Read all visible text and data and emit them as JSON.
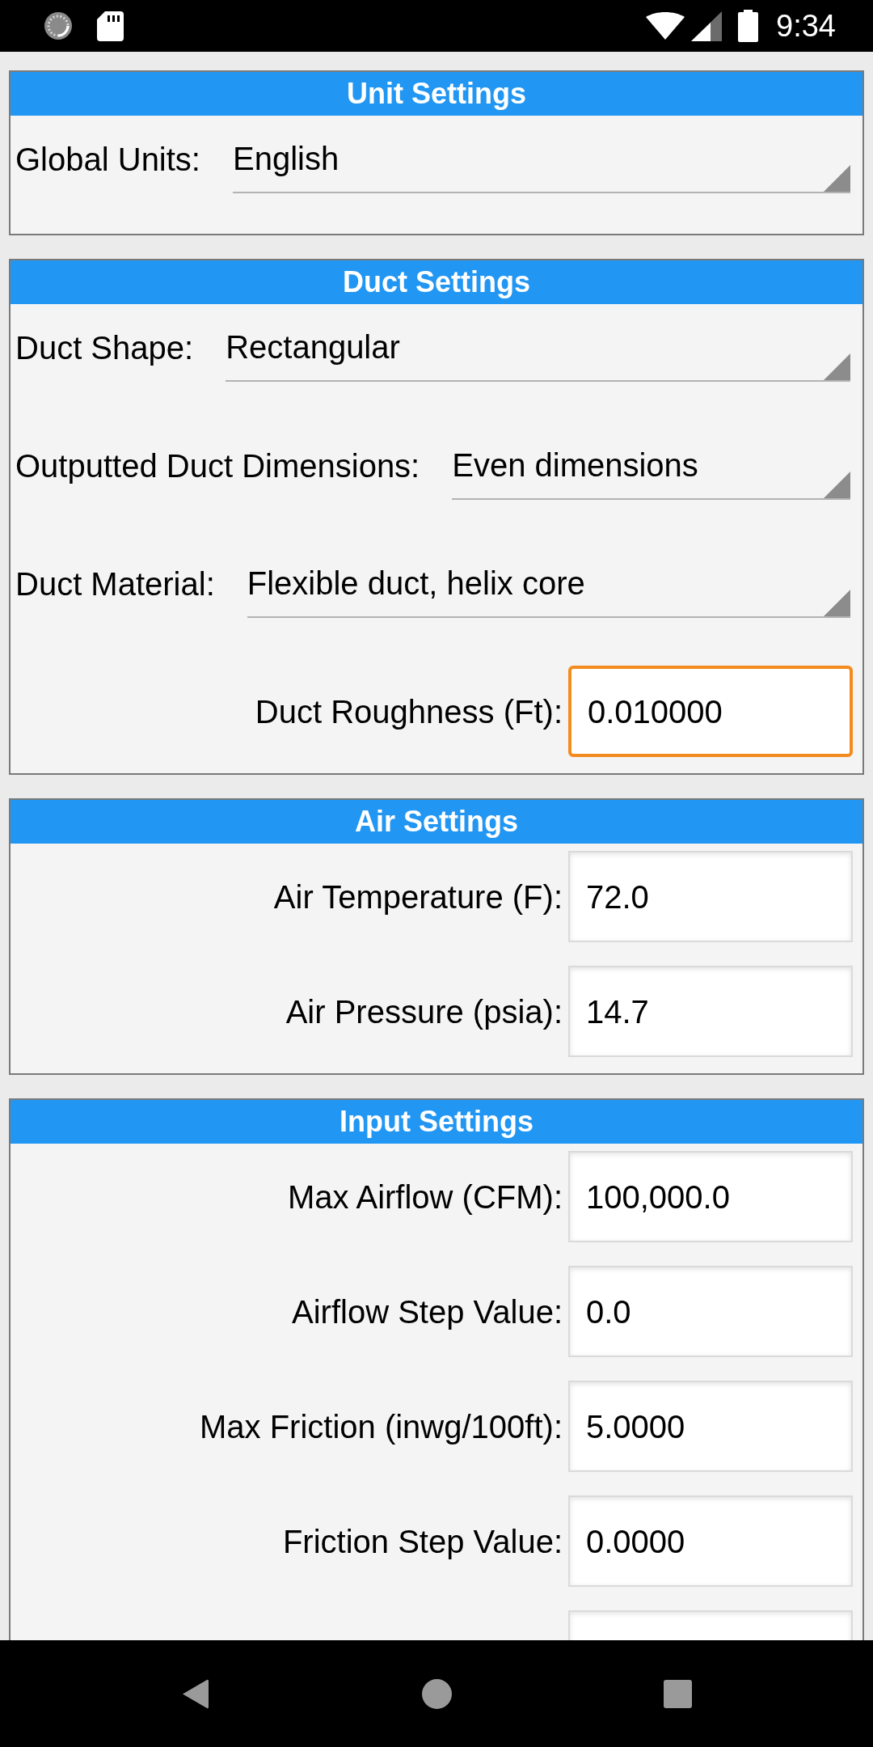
{
  "status_bar": {
    "time": "9:34"
  },
  "sections": [
    {
      "title": "Unit Settings",
      "fields": [
        {
          "kind": "select",
          "label": "Global Units:",
          "value": "English"
        }
      ]
    },
    {
      "title": "Duct Settings",
      "fields": [
        {
          "kind": "select",
          "label": "Duct Shape:",
          "value": "Rectangular"
        },
        {
          "kind": "select",
          "label": "Outputted Duct Dimensions:",
          "value": "Even dimensions"
        },
        {
          "kind": "select",
          "label": "Duct Material:",
          "value": "Flexible duct, helix core"
        },
        {
          "kind": "input",
          "label": "Duct Roughness (Ft):",
          "value": "0.010000",
          "focused": true
        }
      ]
    },
    {
      "title": "Air Settings",
      "fields": [
        {
          "kind": "input",
          "label": "Air Temperature (F):",
          "value": "72.0",
          "focused": false
        },
        {
          "kind": "input",
          "label": "Air Pressure (psia):",
          "value": "14.7",
          "focused": false
        }
      ]
    },
    {
      "title": "Input Settings",
      "fields": [
        {
          "kind": "input",
          "label": "Max Airflow (CFM):",
          "value": "100,000.0",
          "focused": false
        },
        {
          "kind": "input",
          "label": "Airflow Step Value:",
          "value": "0.0",
          "focused": false
        },
        {
          "kind": "input",
          "label": "Max Friction (inwg/100ft):",
          "value": "5.0000",
          "focused": false
        },
        {
          "kind": "input",
          "label": "Friction Step Value:",
          "value": "0.0000",
          "focused": false
        },
        {
          "kind": "input",
          "focused": false
        }
      ]
    }
  ]
}
